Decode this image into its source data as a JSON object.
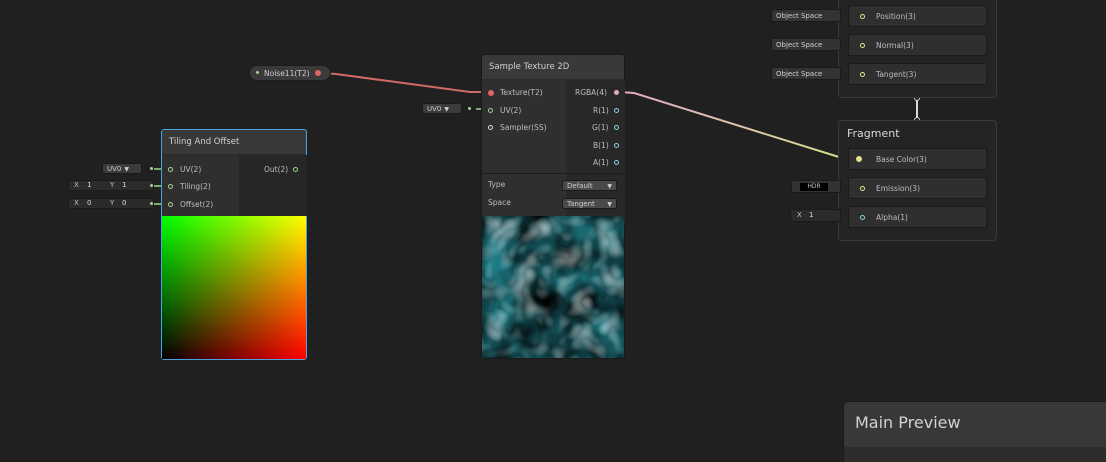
{
  "noise_node": {
    "label": "Noise11(T2)"
  },
  "tiling_node": {
    "title": "Tiling And Offset",
    "uv_dropdown": "UV0",
    "inputs": [
      {
        "label": "UV(2)"
      },
      {
        "label": "Tiling(2)",
        "x_axis": "X",
        "x": "1",
        "y_axis": "Y",
        "y": "1"
      },
      {
        "label": "Offset(2)",
        "x_axis": "X",
        "x": "0",
        "y_axis": "Y",
        "y": "0"
      }
    ],
    "output": "Out(2)"
  },
  "sample_node": {
    "title": "Sample Texture 2D",
    "uv_dropdown": "UV0",
    "inputs": [
      "Texture(T2)",
      "UV(2)",
      "Sampler(SS)"
    ],
    "outputs": [
      "RGBA(4)",
      "R(1)",
      "G(1)",
      "B(1)",
      "A(1)"
    ],
    "type_label": "Type",
    "type_value": "Default",
    "space_label": "Space",
    "space_value": "Tangent"
  },
  "vertex_block": {
    "slots": [
      {
        "space": "Object Space",
        "label": "Position(3)"
      },
      {
        "space": "Object Space",
        "label": "Normal(3)"
      },
      {
        "space": "Object Space",
        "label": "Tangent(3)"
      }
    ]
  },
  "fragment_block": {
    "title": "Fragment",
    "slots": [
      {
        "label": "Base Color(3)"
      },
      {
        "label": "Emission(3)",
        "field": "HDR"
      },
      {
        "label": "Alpha(1)",
        "axis": "X",
        "value": "1"
      }
    ]
  },
  "main_preview": {
    "title": "Main Preview"
  },
  "colors": {
    "background": "#202020",
    "node_bg": "#2a2a2a",
    "node_header": "#393939",
    "selection": "#4aa3df",
    "texture_wire": "#d06a66",
    "vector_port": "#9fd38f",
    "float_port": "#84d6e0"
  }
}
